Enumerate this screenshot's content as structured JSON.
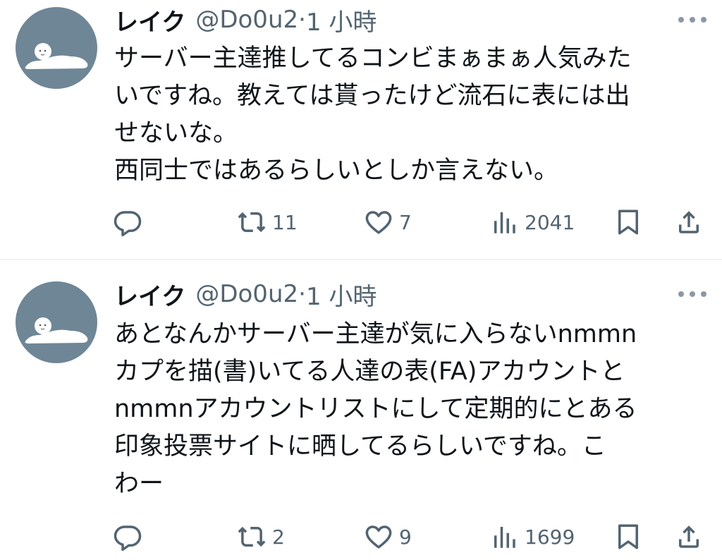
{
  "tweets": [
    {
      "name": "レイク",
      "handle": "@Do0u2",
      "time": "1 小時",
      "lines": [
        "サーバー主達推してるコンビまぁまぁ人気みた",
        "いですね。教えては貰ったけど流石に表には出",
        "せないな。",
        "西同士ではあるらしいとしか言えない。"
      ],
      "retweets": "11",
      "likes": "7",
      "views": "2041"
    },
    {
      "name": "レイク",
      "handle": "@Do0u2",
      "time": "1 小時",
      "lines": [
        "あとなんかサーバー主達が気に入らないnmmn",
        "カプを描(書)いてる人達の表(FA)アカウントと",
        "nmmnアカウントリストにして定期的にとある",
        "印象投票サイトに晒してるらしいですね。こ",
        "わー"
      ],
      "retweets": "2",
      "likes": "9",
      "views": "1699"
    }
  ],
  "icons": {
    "reply": "reply-icon",
    "retweet": "retweet-icon",
    "like": "heart-icon",
    "views": "views-icon",
    "bookmark": "bookmark-icon",
    "share": "share-icon",
    "more": "more-icon"
  },
  "colors": {
    "avatar_bg": "#6f8697",
    "icon_gray": "#536471",
    "text": "#0f1419"
  }
}
